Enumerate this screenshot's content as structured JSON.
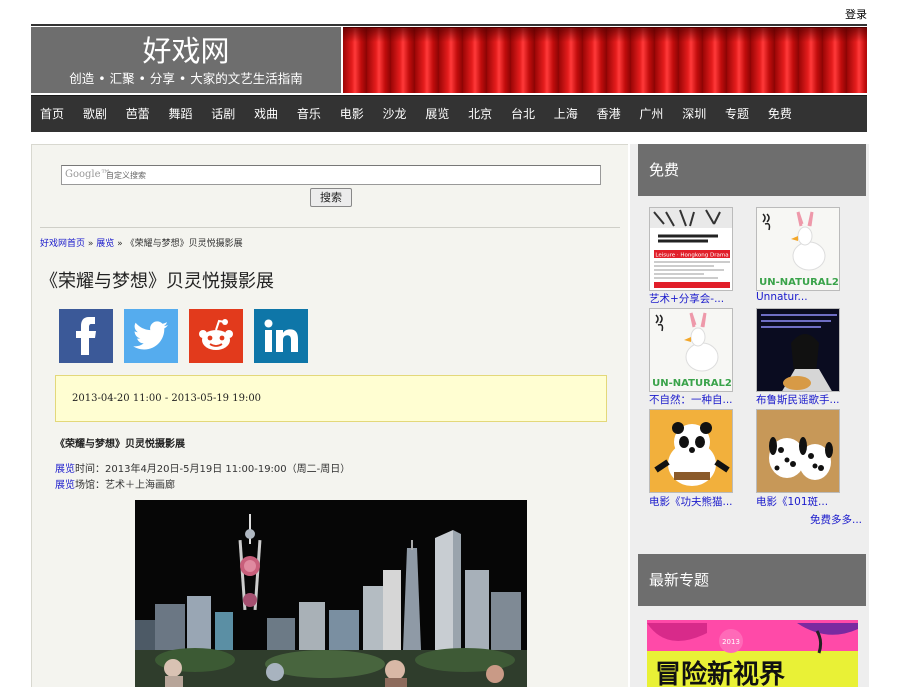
{
  "header": {
    "login": "登录",
    "site_title": "好戏网",
    "tagline": "创造 • 汇聚 • 分享 • 大家的文艺生活指南"
  },
  "nav": [
    "首页",
    "歌剧",
    "芭蕾",
    "舞蹈",
    "话剧",
    "戏曲",
    "音乐",
    "电影",
    "沙龙",
    "展览",
    "北京",
    "台北",
    "上海",
    "香港",
    "广州",
    "深圳",
    "专题",
    "免费"
  ],
  "search": {
    "logo_text": "Google™",
    "placeholder": "自定义搜索",
    "button": "搜索"
  },
  "breadcrumb": {
    "home": "好戏网首页",
    "sep1": "»",
    "section": "展览",
    "sep2": "»",
    "current": "《荣耀与梦想》贝灵悦摄影展"
  },
  "article": {
    "title": "《荣耀与梦想》贝灵悦摄影展",
    "social": [
      "facebook",
      "twitter",
      "reddit",
      "linkedin"
    ],
    "date_range": "2013-04-20 11:00 - 2013-05-19 19:00",
    "subtitle": "《荣耀与梦想》贝灵悦摄影展",
    "time_link": "展览",
    "time_text": "时间：2013年4月20日-5月19日 11:00-19:00（周二-周日）",
    "venue_link": "展览",
    "venue_text": "场馆：艺术＋上海画廊"
  },
  "sidebar": {
    "free_heading": "免费",
    "items": [
      {
        "caption": "艺术+分享会-...",
        "poster": "poster-leisure"
      },
      {
        "caption": "Unnatur...",
        "poster": "poster-duck"
      },
      {
        "caption": "不自然：一种自...",
        "poster": "poster-duck"
      },
      {
        "caption": "布鲁斯民谣歌手...",
        "poster": "poster-singer"
      },
      {
        "caption": "电影《功夫熊猫...",
        "poster": "poster-panda"
      },
      {
        "caption": "电影《101斑...",
        "poster": "poster-dalmatians"
      }
    ],
    "more": "免费多多...",
    "topic_heading": "最新专题",
    "banner_text": "冒险新视界",
    "banner_year": "2013"
  },
  "poster_texts": {
    "leisure": "Leisure · Hongkong Drama",
    "unnatural": "UN-NATURAL2"
  },
  "colors": {
    "nav_bg": "#333333",
    "brand_bg": "#6e6e6e",
    "link": "#1a1acc",
    "date_box": "#fffed2"
  }
}
